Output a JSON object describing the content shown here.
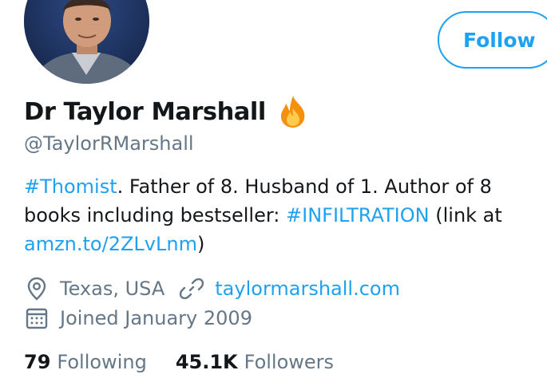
{
  "profile": {
    "display_name": "Dr Taylor Marshall",
    "name_emoji": "fire-icon",
    "handle": "@TaylorRMarshall",
    "follow_label": "Follow"
  },
  "bio": {
    "line1_hashtag": "#Thomist",
    "line1_text": ". Father of 8. Husband of 1. Author of 8",
    "line2_text": "books including bestseller: ",
    "line2_hashtag": "#INFILTRATION",
    "line2_tail": " (link at",
    "line3_link": "amzn.to/2ZLvLnm",
    "line3_tail": ")"
  },
  "meta": {
    "location_icon": "location-pin-icon",
    "location": "Texas, USA",
    "website_icon": "link-icon",
    "website": "taylormarshall.com",
    "joined_icon": "calendar-icon",
    "joined": "Joined January 2009"
  },
  "stats": {
    "following_count": "79",
    "following_label": "Following",
    "followers_count": "45.1K",
    "followers_label": "Followers"
  },
  "colors": {
    "accent": "#1da1f2",
    "text": "#14171a",
    "secondary": "#657786"
  }
}
